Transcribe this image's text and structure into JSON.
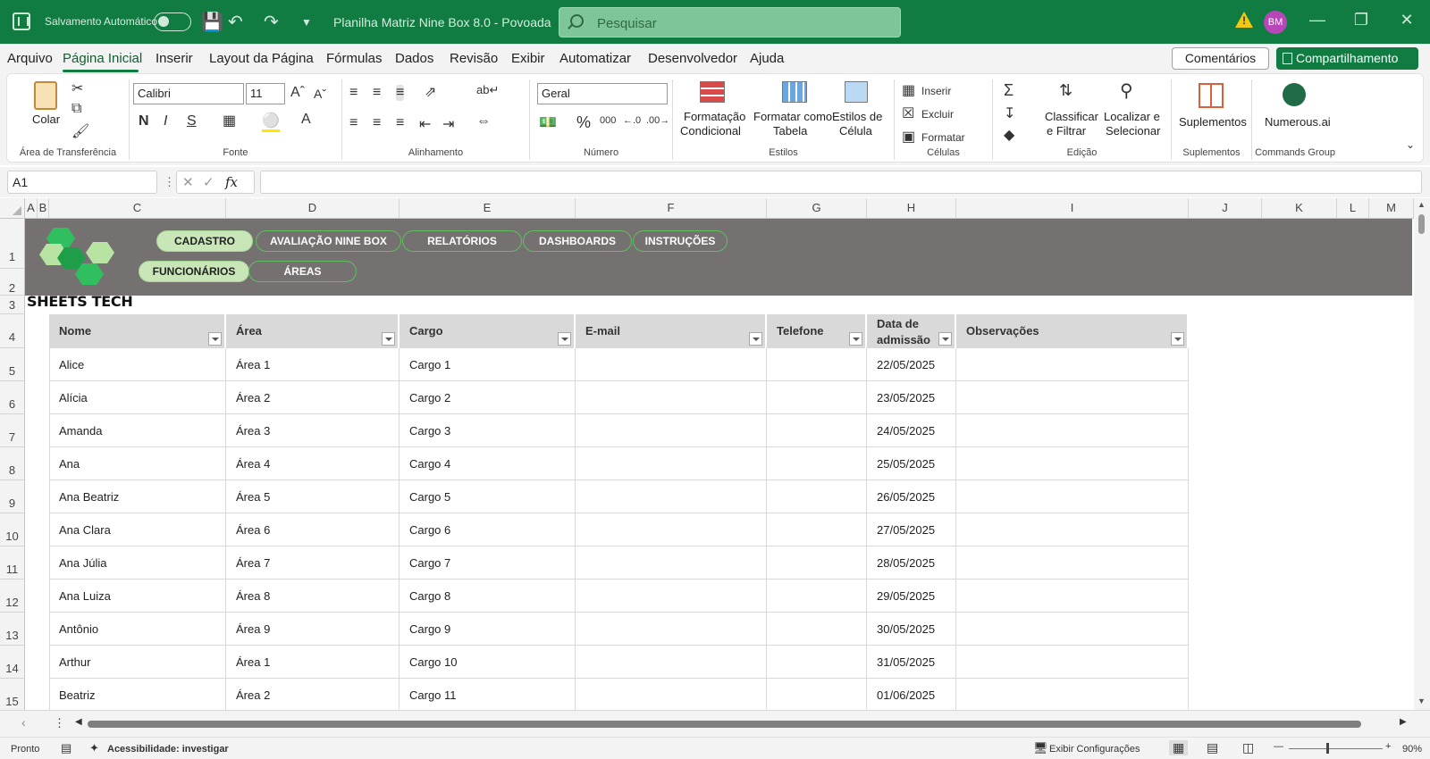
{
  "titlebar": {
    "autosave_label": "Salvamento Automático",
    "doc_title": "Planilha Matriz Nine Box 8.0 - Povoada",
    "search_placeholder": "Pesquisar",
    "avatar_initials": "BM"
  },
  "menu": {
    "items": [
      "Arquivo",
      "Página Inicial",
      "Inserir",
      "Layout da Página",
      "Fórmulas",
      "Dados",
      "Revisão",
      "Exibir",
      "Automatizar",
      "Desenvolvedor",
      "Ajuda"
    ],
    "comments_label": "Comentários",
    "share_label": "Compartilhamento"
  },
  "ribbon": {
    "clipboard": {
      "paste_label": "Colar",
      "group_label": "Área de Transferência"
    },
    "font": {
      "family": "Calibri",
      "size": "11",
      "group_label": "Fonte"
    },
    "alignment": {
      "group_label": "Alinhamento"
    },
    "number": {
      "format": "Geral",
      "group_label": "Número"
    },
    "styles": {
      "conditional_line1": "Formatação",
      "conditional_line2": "Condicional",
      "table_line1": "Formatar como",
      "table_line2": "Tabela",
      "cell_line1": "Estilos de",
      "cell_line2": "Célula",
      "group_label": "Estilos"
    },
    "cells": {
      "insert": "Inserir",
      "delete": "Excluir",
      "format": "Formatar",
      "group_label": "Células"
    },
    "editing": {
      "sort_line1": "Classificar",
      "sort_line2": "e Filtrar",
      "find_line1": "Localizar e",
      "find_line2": "Selecionar",
      "group_label": "Edição"
    },
    "addins": {
      "label": "Suplementos",
      "group_label": "Suplementos"
    },
    "commands": {
      "label": "Numerous.ai",
      "group_label": "Commands Group"
    }
  },
  "formula_bar": {
    "name_box": "A1",
    "formula": ""
  },
  "columns": [
    "A",
    "B",
    "C",
    "D",
    "E",
    "F",
    "G",
    "H",
    "I",
    "J",
    "K",
    "L",
    "M"
  ],
  "rows": [
    "1",
    "2",
    "3",
    "4",
    "5",
    "6",
    "7",
    "8",
    "9",
    "10",
    "11",
    "12",
    "13",
    "14",
    "15"
  ],
  "nav": {
    "top": [
      "CADASTRO",
      "AVALIAÇÃO NINE BOX",
      "RELATÓRIOS",
      "DASHBOARDS",
      "INSTRUÇÕES"
    ],
    "bottom": [
      "FUNCIONÁRIOS",
      "ÁREAS"
    ]
  },
  "brand": "SHEETS TECH",
  "table": {
    "headers": [
      "Nome",
      "Área",
      "Cargo",
      "E-mail",
      "Telefone",
      "Data de admissão",
      "Observações"
    ],
    "rows": [
      [
        "Alice",
        "Área 1",
        "Cargo 1",
        "",
        "",
        "22/05/2025",
        ""
      ],
      [
        "Alícia",
        "Área 2",
        "Cargo 2",
        "",
        "",
        "23/05/2025",
        ""
      ],
      [
        "Amanda",
        "Área 3",
        "Cargo 3",
        "",
        "",
        "24/05/2025",
        ""
      ],
      [
        "Ana",
        "Área 4",
        "Cargo 4",
        "",
        "",
        "25/05/2025",
        ""
      ],
      [
        "Ana Beatriz",
        "Área 5",
        "Cargo 5",
        "",
        "",
        "26/05/2025",
        ""
      ],
      [
        "Ana Clara",
        "Área 6",
        "Cargo 6",
        "",
        "",
        "27/05/2025",
        ""
      ],
      [
        "Ana Júlia",
        "Área 7",
        "Cargo 7",
        "",
        "",
        "28/05/2025",
        ""
      ],
      [
        "Ana Luiza",
        "Área 8",
        "Cargo 8",
        "",
        "",
        "29/05/2025",
        ""
      ],
      [
        "Antônio",
        "Área 9",
        "Cargo 9",
        "",
        "",
        "30/05/2025",
        ""
      ],
      [
        "Arthur",
        "Área 1",
        "Cargo 10",
        "",
        "",
        "31/05/2025",
        ""
      ],
      [
        "Beatriz",
        "Área 2",
        "Cargo 11",
        "",
        "",
        "01/06/2025",
        ""
      ]
    ]
  },
  "status": {
    "ready": "Pronto",
    "accessibility": "Acessibilidade: investigar",
    "display_settings": "Exibir Configurações",
    "zoom": "90%"
  },
  "colors": {
    "excel_green": "#107c41",
    "banner_gray": "#767171",
    "header_gray": "#d9d9d9",
    "nav_active": "#c8e6b8"
  }
}
